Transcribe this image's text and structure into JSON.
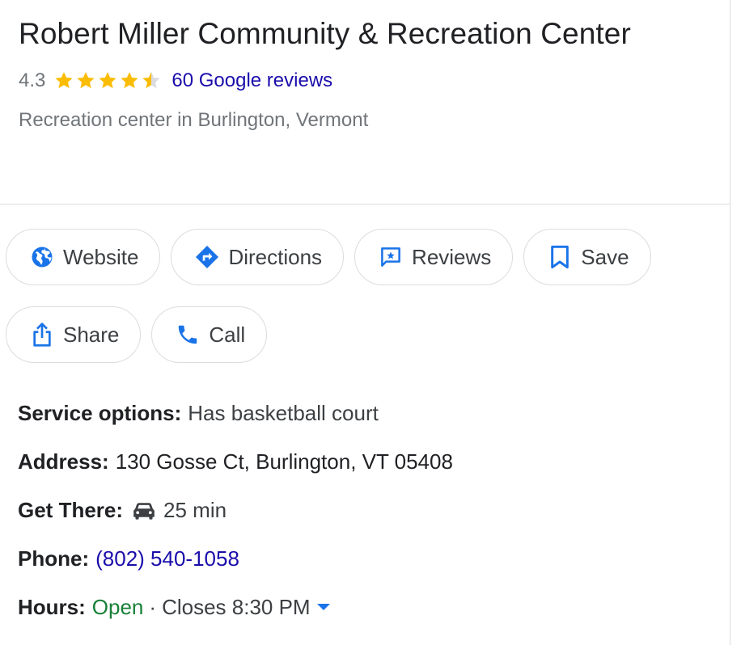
{
  "place": {
    "name": "Robert Miller Community & Recreation Center",
    "rating": "4.3",
    "rating_value": 4.3,
    "reviews_link": "60 Google reviews",
    "category": "Recreation center in Burlington, Vermont"
  },
  "actions": {
    "website": "Website",
    "directions": "Directions",
    "reviews": "Reviews",
    "save": "Save",
    "share": "Share",
    "call": "Call"
  },
  "details": {
    "service_label": "Service options:",
    "service_value": "Has basketball court",
    "address_label": "Address:",
    "address_value": "130 Gosse Ct, Burlington, VT 05408",
    "getthere_label": "Get There:",
    "getthere_value": "25 min",
    "phone_label": "Phone:",
    "phone_value": "(802) 540-1058",
    "hours_label": "Hours:",
    "hours_status": "Open",
    "hours_separator": "·",
    "hours_closes": "Closes 8:30 PM"
  },
  "colors": {
    "star": "#fbbc04",
    "star_empty": "#dadce0",
    "link": "#1a0dab",
    "icon_blue": "#1a73e8",
    "open_green": "#188038"
  },
  "icons": {
    "website": "globe-icon",
    "directions": "directions-diamond-icon",
    "reviews": "review-star-bubble-icon",
    "save": "bookmark-icon",
    "share": "share-upload-icon",
    "call": "phone-icon",
    "get_there": "car-icon",
    "hours_toggle": "caret-down-icon"
  }
}
